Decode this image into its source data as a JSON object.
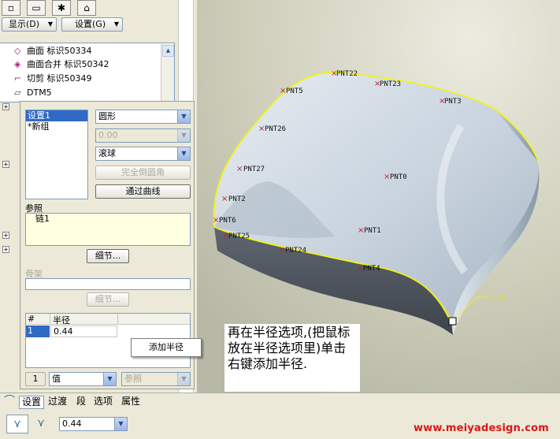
{
  "header": {
    "show_menu": "显示(D)",
    "settings_menu": "设置(G)"
  },
  "tree": {
    "items": [
      {
        "label": "曲面 标识50334"
      },
      {
        "label": "曲面合并 标识50342"
      },
      {
        "label": "切剪 标识50349"
      },
      {
        "label": "DTM5"
      }
    ]
  },
  "round_panel": {
    "sets": [
      "设置1",
      "*新组"
    ],
    "shape": "圆形",
    "distance": "0.00",
    "method": "滚球",
    "full_round_button": "完全倒圆角",
    "through_curve_button": "通过曲线",
    "references_label": "参照",
    "references_value": "链1",
    "details_button": "细节...",
    "spine_label": "骨架",
    "spine_details_button": "细节...",
    "radius_table": {
      "headers": [
        "#",
        "半径"
      ],
      "rows": [
        {
          "index": "1",
          "radius": "0.44"
        }
      ]
    },
    "footer": {
      "count": "1",
      "type": "值",
      "ref": "参照"
    }
  },
  "context_menu": {
    "add_radius": "添加半径"
  },
  "dashboard": {
    "tabs": [
      "设置",
      "过渡",
      "段",
      "选项",
      "属性"
    ],
    "radius_value": "0.44"
  },
  "viewport": {
    "points": [
      {
        "name": "PNT22"
      },
      {
        "name": "PNT23"
      },
      {
        "name": "PNT5"
      },
      {
        "name": "PNT3"
      },
      {
        "name": "PNT26"
      },
      {
        "name": "PNT27"
      },
      {
        "name": "PNT0"
      },
      {
        "name": "PNT2"
      },
      {
        "name": "PNT6"
      },
      {
        "name": "PNT1"
      },
      {
        "name": "PNT25"
      },
      {
        "name": "PNT24"
      },
      {
        "name": "PNT4"
      }
    ],
    "dimension_label": "0.44"
  },
  "annotation": "再在半径选项,(把鼠标放在半径选项里)单击右键添加半径.",
  "watermark": "www.meiyadesign.com"
}
